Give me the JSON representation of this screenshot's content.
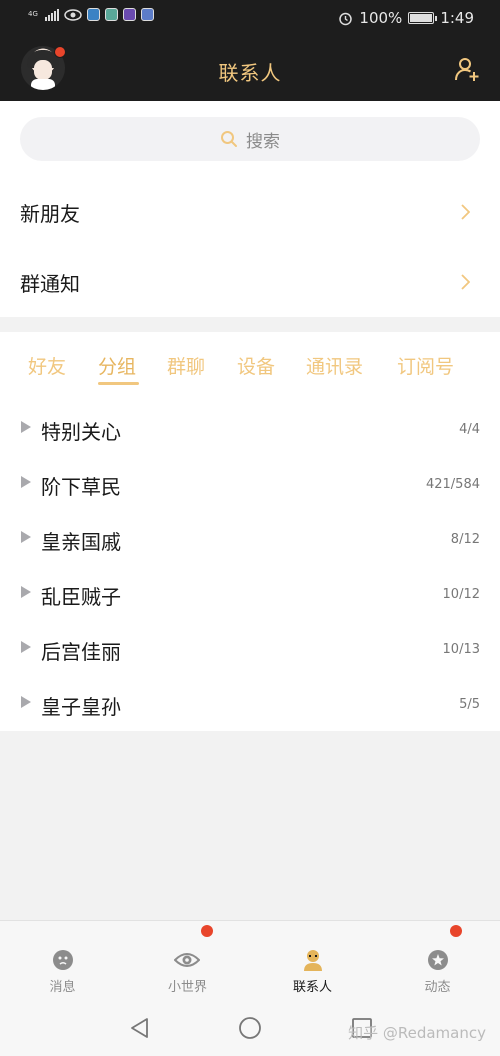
{
  "status_bar": {
    "network_label": "4G",
    "battery": "100%",
    "battery_level": 1.0,
    "time": "1:49",
    "icons": [
      "signal-icon",
      "eye-icon",
      "app-icon-1",
      "app-icon-2",
      "app-icon-3",
      "app-icon-4",
      "alarm-icon",
      "battery-icon"
    ]
  },
  "header": {
    "title": "联系人",
    "avatar_badge": true,
    "add_icon": "add-friend-icon"
  },
  "search": {
    "placeholder": "搜索",
    "icon": "search-icon"
  },
  "rows": [
    {
      "label": "新朋友"
    },
    {
      "label": "群通知"
    }
  ],
  "tabs": [
    {
      "label": "好友",
      "active": false
    },
    {
      "label": "分组",
      "active": true
    },
    {
      "label": "群聊",
      "active": false
    },
    {
      "label": "设备",
      "active": false
    },
    {
      "label": "通讯录",
      "active": false
    },
    {
      "label": "订阅号",
      "active": false
    }
  ],
  "groups": [
    {
      "name": "特别关心",
      "count": "4/4"
    },
    {
      "name": "阶下草民",
      "count": "421/584"
    },
    {
      "name": "皇亲国戚",
      "count": "8/12"
    },
    {
      "name": "乱臣贼子",
      "count": "10/12"
    },
    {
      "name": "后宫佳丽",
      "count": "10/13"
    },
    {
      "name": "皇子皇孙",
      "count": "5/5"
    }
  ],
  "bottom_nav": [
    {
      "label": "消息",
      "icon": "message-icon",
      "badge": false,
      "active": false
    },
    {
      "label": "小世界",
      "icon": "small-world-icon",
      "badge": true,
      "active": false
    },
    {
      "label": "联系人",
      "icon": "contacts-icon",
      "badge": false,
      "active": true
    },
    {
      "label": "动态",
      "icon": "moments-icon",
      "badge": true,
      "active": false
    }
  ],
  "watermark": "知乎 @Redamancy",
  "colors": {
    "accent": "#f1c77f",
    "header_bg": "#1d1d1d",
    "badge": "#e8452b"
  }
}
